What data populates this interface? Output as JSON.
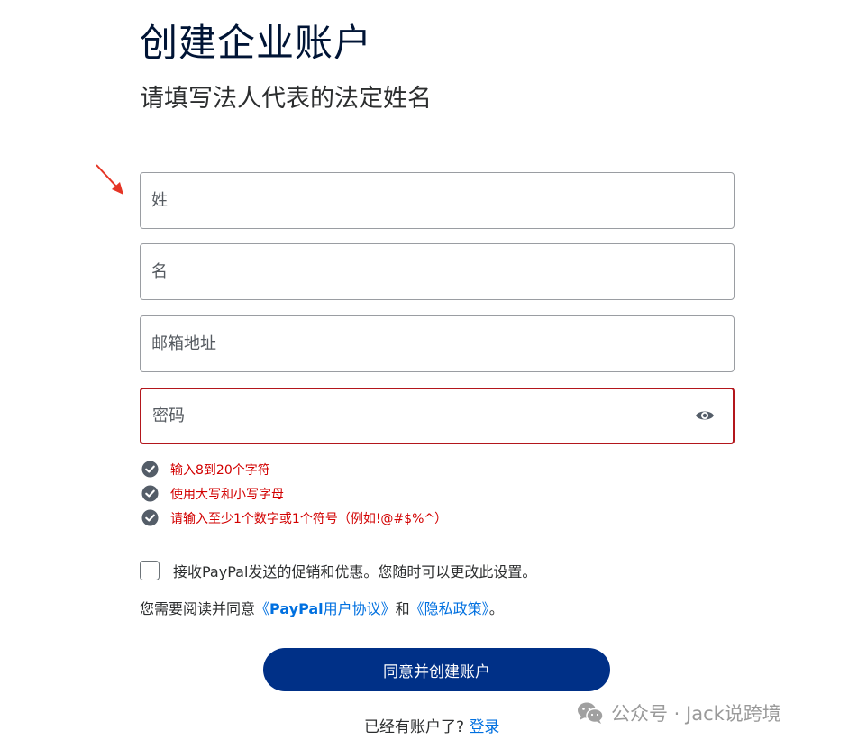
{
  "header": {
    "title": "创建企业账户",
    "subtitle": "请填写法人代表的法定姓名"
  },
  "form": {
    "last_name_placeholder": "姓",
    "first_name_placeholder": "名",
    "email_placeholder": "邮箱地址",
    "password_placeholder": "密码"
  },
  "password_rules": [
    "输入8到20个字符",
    "使用大写和小写字母",
    "请输入至少1个数字或1个符号（例如!@#$%^）"
  ],
  "optin_label": "接收PayPal发送的促销和优惠。您随时可以更改此设置。",
  "legal": {
    "prefix": "您需要阅读并同意",
    "agreement_open": "《",
    "agreement_brand": "PayPal",
    "agreement_rest": "用户协议》",
    "and": "和",
    "privacy": "《隐私政策》",
    "suffix": "。"
  },
  "submit_label": "同意并创建账户",
  "login": {
    "prompt": "已经有账户了?",
    "link": "登录"
  },
  "watermark": "公众号 · Jack说跨境",
  "colors": {
    "primary": "#003087",
    "link": "#0070e0",
    "error": "#d20000",
    "title": "#001435"
  },
  "icons": {
    "annotation_arrow": "red-arrow",
    "password_toggle": "eye-icon",
    "rule_check": "check-circle-icon",
    "watermark_logo": "wechat-icon"
  }
}
